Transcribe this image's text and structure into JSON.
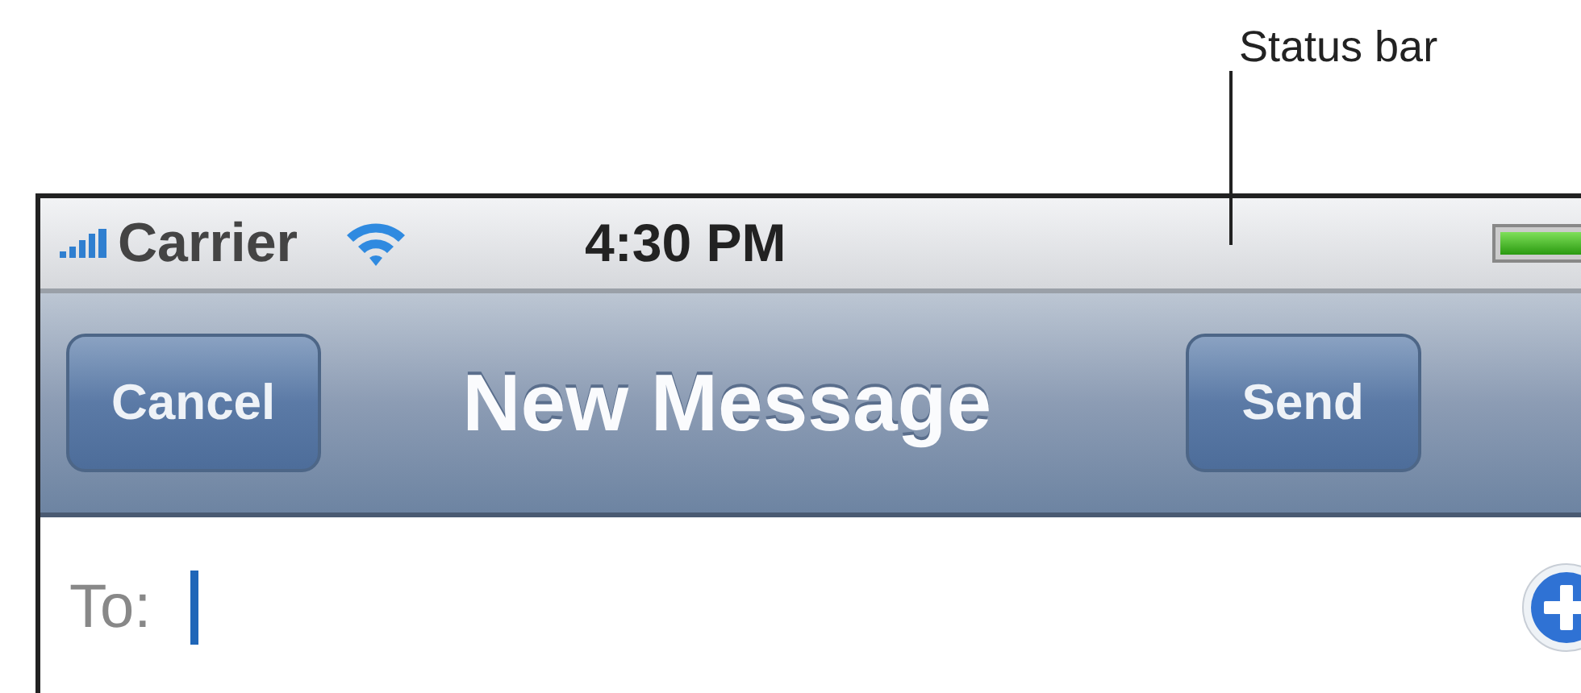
{
  "callout": {
    "label": "Status bar"
  },
  "status_bar": {
    "carrier": "Carrier",
    "time": "4:30 PM"
  },
  "nav_bar": {
    "left_button": "Cancel",
    "title": "New Message",
    "right_button": "Send"
  },
  "recipient_field": {
    "label": "To:"
  }
}
